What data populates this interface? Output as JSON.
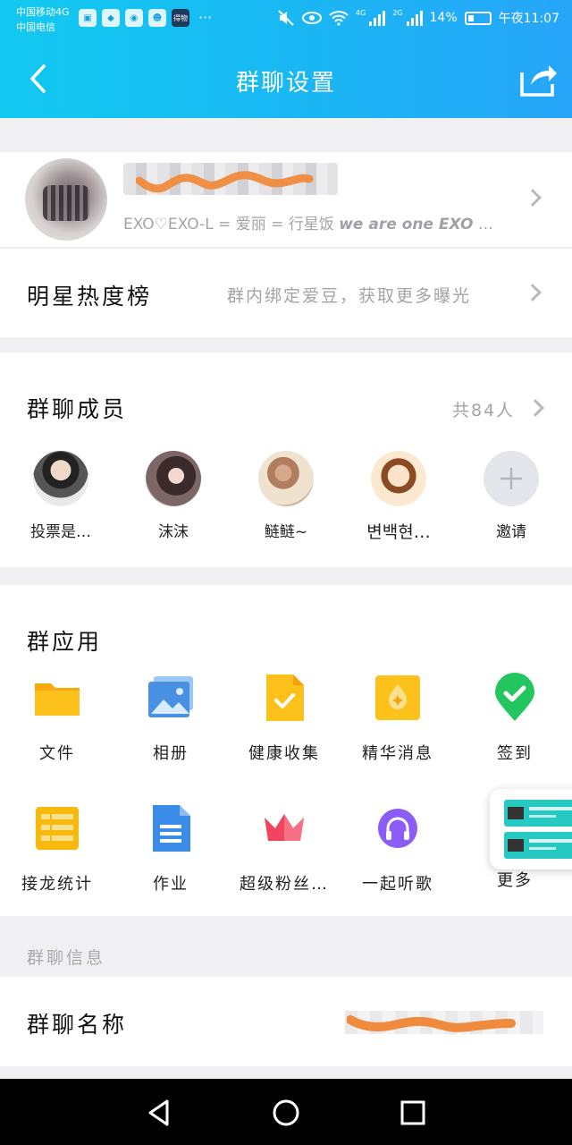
{
  "status_bar": {
    "carrier_1": "中国移动4G",
    "carrier_2": "中国电信",
    "app_icon_label": "得物",
    "battery": "14%",
    "time": "午夜11:07",
    "network_1": "4G",
    "network_2": "2G"
  },
  "nav": {
    "title": "群聊设置"
  },
  "profile": {
    "description_cn": "EXO♡EXO-L = 爱丽 = 行星饭 ",
    "description_en": "we are one EXO",
    "description_tail": " …"
  },
  "star_rank": {
    "title": "明星热度榜",
    "subtitle": "群内绑定爱豆，获取更多曝光"
  },
  "members": {
    "title": "群聊成员",
    "count": "共84人",
    "items": [
      {
        "name": "投票是…"
      },
      {
        "name": "沫沫"
      },
      {
        "name": "鲢鲢~"
      },
      {
        "name": "변백현…"
      },
      {
        "name": "邀请"
      }
    ]
  },
  "apps": {
    "title": "群应用",
    "items": [
      {
        "label": "文件",
        "icon": "folder-icon"
      },
      {
        "label": "相册",
        "icon": "album-icon"
      },
      {
        "label": "健康收集",
        "icon": "health-form-icon"
      },
      {
        "label": "精华消息",
        "icon": "essence-icon"
      },
      {
        "label": "签到",
        "icon": "checkin-icon"
      },
      {
        "label": "接龙统计",
        "icon": "relay-icon"
      },
      {
        "label": "作业",
        "icon": "homework-icon"
      },
      {
        "label": "超级粉丝…",
        "icon": "crown-icon"
      },
      {
        "label": "一起听歌",
        "icon": "headphones-icon"
      },
      {
        "label": "更多",
        "icon": "more-icon"
      }
    ]
  },
  "info": {
    "section_label": "群聊信息",
    "group_name_label": "群聊名称"
  },
  "colors": {
    "header_start": "#12c9f0",
    "header_end": "#27a5f9",
    "folder": "#fcc21b",
    "album": "#4a90e2",
    "checkin": "#22c55e",
    "crown": "#f0445f",
    "headphones": "#8b5cf6",
    "redaction": "#f08a3c"
  }
}
